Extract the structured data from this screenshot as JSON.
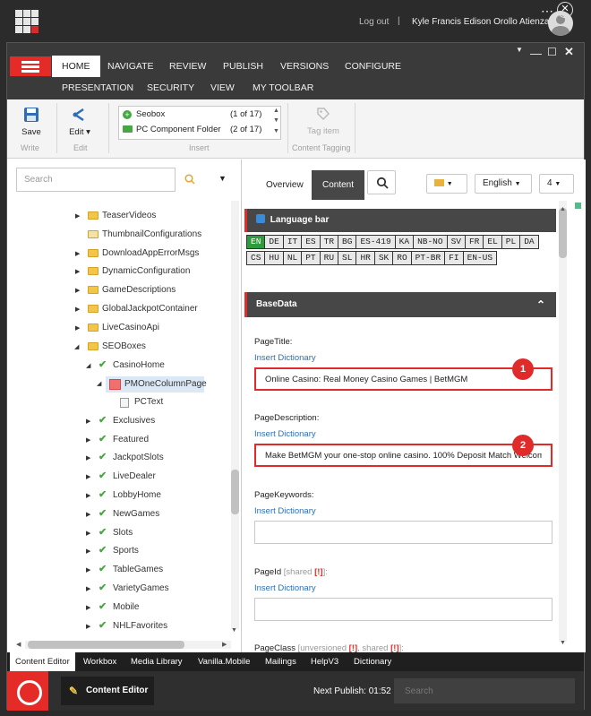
{
  "top": {
    "logout": "Log out",
    "separator": "|",
    "username": "Kyle Francis Edison Orollo Atienza"
  },
  "tabs": [
    "HOME",
    "NAVIGATE",
    "REVIEW",
    "PUBLISH",
    "VERSIONS",
    "CONFIGURE",
    "PRESENTATION",
    "SECURITY",
    "VIEW",
    "MY TOOLBAR"
  ],
  "ribbon": {
    "save": "Save",
    "edit": "Edit",
    "write_group": "Write",
    "edit_group": "Edit",
    "insert_group": "Insert",
    "insert_items": [
      {
        "label": "Seobox",
        "count": "(1 of 17)"
      },
      {
        "label": "PC Component Folder",
        "count": "(2 of 17)"
      }
    ],
    "tag_item": "Tag item",
    "content_tagging": "Content Tagging"
  },
  "tree": {
    "search_placeholder": "Search",
    "items": [
      {
        "label": "TeaserVideos"
      },
      {
        "label": "ThumbnailConfigurations"
      },
      {
        "label": "DownloadAppErrorMsgs"
      },
      {
        "label": "DynamicConfiguration"
      },
      {
        "label": "GameDescriptions"
      },
      {
        "label": "GlobalJackpotContainer"
      },
      {
        "label": "LiveCasinoApi"
      },
      {
        "label": "SEOBoxes"
      },
      {
        "label": "CasinoHome"
      },
      {
        "label": "PMOneColumnPage"
      },
      {
        "label": "PCText"
      },
      {
        "label": "Exclusives"
      },
      {
        "label": "Featured"
      },
      {
        "label": "JackpotSlots"
      },
      {
        "label": "LiveDealer"
      },
      {
        "label": "LobbyHome"
      },
      {
        "label": "NewGames"
      },
      {
        "label": "Slots"
      },
      {
        "label": "Sports"
      },
      {
        "label": "TableGames"
      },
      {
        "label": "VarietyGames"
      },
      {
        "label": "Mobile"
      },
      {
        "label": "NHLFavorites"
      }
    ]
  },
  "editor": {
    "tab_overview": "Overview",
    "tab_content": "Content",
    "language": "English",
    "version": "4",
    "language_bar_title": "Language bar",
    "languages": [
      "EN",
      "DE",
      "IT",
      "ES",
      "TR",
      "BG",
      "ES-419",
      "KA",
      "NB-NO",
      "SV",
      "FR",
      "EL",
      "PL",
      "DA",
      "CS",
      "HU",
      "NL",
      "PT",
      "RU",
      "SL",
      "HR",
      "SK",
      "RO",
      "PT-BR",
      "FI",
      "EN-US"
    ],
    "basedata_title": "BaseData",
    "insert_dictionary": "Insert Dictionary",
    "fields": {
      "page_title_label": "PageTitle:",
      "page_title_value": "Online Casino: Real Money Casino Games | BetMGM",
      "page_desc_label": "PageDescription:",
      "page_desc_value": "Make BetMGM your one-stop online casino. 100% Deposit Match Welcome",
      "page_keywords_label": "PageKeywords:",
      "page_id_label": "PageId",
      "page_id_shared": "[shared ",
      "page_class_label": "PageClass",
      "page_class_meta": "[unversioned ",
      "page_class_meta2": ", shared ",
      "warn": "[!]",
      "close_bracket": "]:",
      "close_bracket2": "]:"
    },
    "badges": [
      "1",
      "2"
    ]
  },
  "bottom_tabs": [
    "Content Editor",
    "Workbox",
    "Media Library",
    "Vanilla.Mobile",
    "Mailings",
    "HelpV3",
    "Dictionary"
  ],
  "taskbar": {
    "content_editor": "Content Editor",
    "next_publish": "Next Publish: 01:52",
    "search_placeholder": "Search"
  },
  "colors": {
    "brand_red": "#e52b27",
    "active_lang": "#2e9b3d",
    "link": "#2a6fb5",
    "dark_bar": "#474747"
  }
}
